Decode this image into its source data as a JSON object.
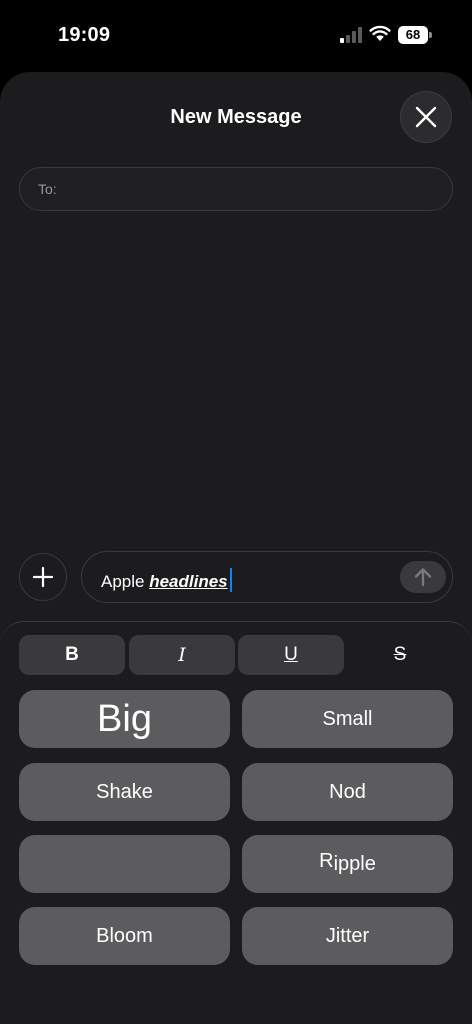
{
  "status_bar": {
    "time": "19:09",
    "battery": "68",
    "signal_bars_active": 1,
    "signal_bars_total": 4
  },
  "sheet": {
    "title": "New Message",
    "to_label": "To:",
    "close_icon": "close-icon"
  },
  "compose": {
    "plain_text": "Apple ",
    "styled_text": "headlines",
    "add_icon": "plus-icon",
    "send_icon": "arrow-up-icon"
  },
  "formatting": {
    "bold": "B",
    "italic": "I",
    "underline": "U",
    "strikethrough": "S",
    "effects": {
      "big": "Big",
      "small": "Small",
      "shake": "Shake",
      "nod": "Nod",
      "explode": "",
      "ripple_first": "R",
      "ripple_rest": "ipple",
      "bloom": "Bloom",
      "jitter": "Jitter"
    }
  },
  "colors": {
    "background": "#000000",
    "sheet": "#1c1c1e",
    "button": "#5c5c5e",
    "caret": "#0a84ff"
  }
}
